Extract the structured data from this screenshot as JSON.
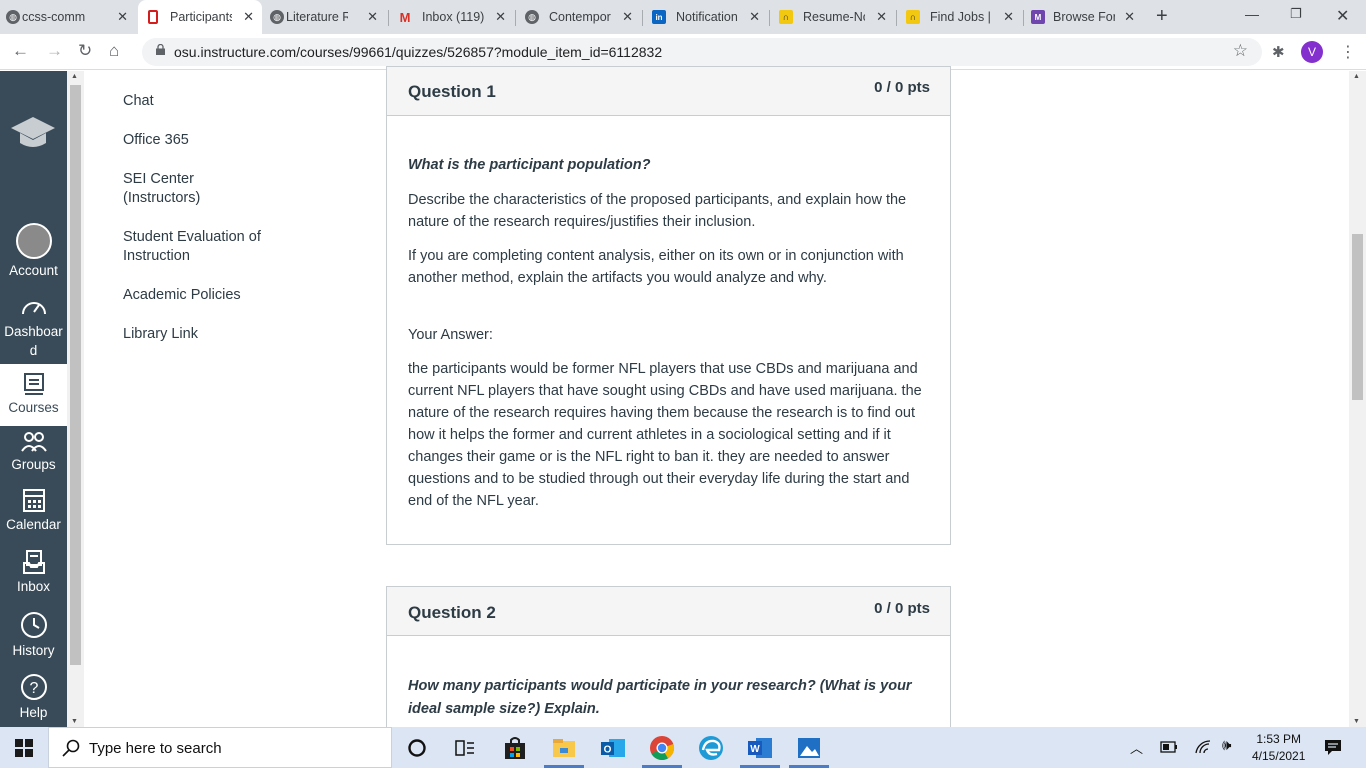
{
  "browser": {
    "tabs": [
      {
        "title": "ccss-comm",
        "favicon": "globe-icon"
      },
      {
        "title": "Participants",
        "favicon": "canvas-icon"
      },
      {
        "title": "Literature R",
        "favicon": "globe-icon"
      },
      {
        "title": "Inbox (119)",
        "favicon": "gmail-icon"
      },
      {
        "title": "Contempor",
        "favicon": "globe-icon"
      },
      {
        "title": "Notification",
        "favicon": "linkedin-icon"
      },
      {
        "title": "Resume-No",
        "favicon": "indeed-icon"
      },
      {
        "title": "Find Jobs | ",
        "favicon": "indeed-icon"
      },
      {
        "title": "Browse For",
        "favicon": "monster-icon"
      }
    ],
    "url": "osu.instructure.com/courses/99661/quizzes/526857?module_item_id=6112832",
    "profile_initial": "V"
  },
  "global_nav": {
    "items": [
      {
        "label": "Account",
        "icon": "avatar-icon"
      },
      {
        "label": "Dashboar d",
        "icon": "dashboard-icon"
      },
      {
        "label": "Courses",
        "icon": "courses-icon"
      },
      {
        "label": "Groups",
        "icon": "groups-icon"
      },
      {
        "label": "Calendar",
        "icon": "calendar-icon"
      },
      {
        "label": "Inbox",
        "icon": "inbox-icon"
      },
      {
        "label": "History",
        "icon": "history-icon"
      },
      {
        "label": "Help",
        "icon": "help-icon"
      }
    ]
  },
  "course_nav": {
    "items": [
      "Chat",
      "Office 365",
      "SEI Center (Instructors)",
      "Student Evaluation of Instruction",
      "Academic Policies",
      "Library Link"
    ]
  },
  "questions": [
    {
      "title": "Question 1",
      "points": "0 / 0 pts",
      "prompt": "What is the participant population?",
      "paragraphs": [
        "Describe the characteristics of the proposed participants, and explain how the nature of the research requires/justifies their inclusion.",
        "If you are completing content analysis, either on its own or in conjunction with another method, explain the artifacts you would analyze and why."
      ],
      "answer_label": "Your Answer:",
      "answer": "the participants would be former NFL players that use CBDs and marijuana and current NFL players that have sought using CBDs and have used marijuana. the nature of the research requires having them because the research is to find out how it helps the former and current athletes in a sociological setting and if it changes their game or is the NFL right to ban it. they are needed to answer questions and to be studied through out their everyday life during the start and end of the NFL year."
    },
    {
      "title": "Question 2",
      "points": "0 / 0 pts",
      "prompt": "How many participants would participate in your research? (What is your ideal sample size?) Explain."
    }
  ],
  "taskbar": {
    "search_placeholder": "Type here to search",
    "time": "1:53 PM",
    "date": "4/15/2021"
  },
  "colors": {
    "nav_bg": "#394b58",
    "text": "#2d3b45",
    "profile": "#8430ce"
  }
}
